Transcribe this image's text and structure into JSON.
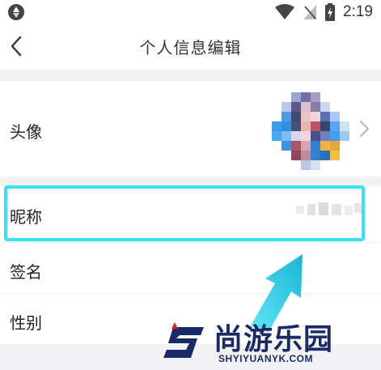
{
  "status_bar": {
    "app_icon": "aperture-icon",
    "wifi_icon": "wifi-icon",
    "signal_icon": "no-signal-icon",
    "battery_icon": "battery-charging-icon",
    "time": "2:19"
  },
  "nav": {
    "back_icon": "chevron-left-icon",
    "title": "个人信息编辑"
  },
  "profile": {
    "avatar_label": "头像",
    "nickname_label": "昵称",
    "signature_label": "签名",
    "gender_label": "性别"
  },
  "highlight": {
    "color": "#37e3f2",
    "target": "nickname"
  },
  "watermark": {
    "name": "尚游乐园",
    "url": "SHYIYUANYK.COM",
    "color": "#1a2a66",
    "accent": "#e02020"
  }
}
